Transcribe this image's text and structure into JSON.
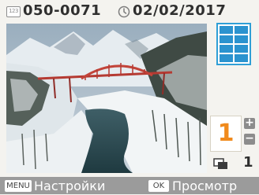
{
  "header": {
    "file_icon_label": "123",
    "file_number": "050-0071",
    "date": "02/02/2017"
  },
  "photo": {
    "description_icon": "photo-preview"
  },
  "layout": {
    "icon": "grid-layout-icon",
    "accent_color": "#2b93cf"
  },
  "quantity": {
    "value": "1",
    "plus": "+",
    "minus": "−",
    "accent_color": "#f08a1c"
  },
  "copies": {
    "count": "1"
  },
  "footer": {
    "menu_key": "MENU",
    "menu_label": "Настройки",
    "ok_key": "OK",
    "ok_label": "Просмотр"
  }
}
